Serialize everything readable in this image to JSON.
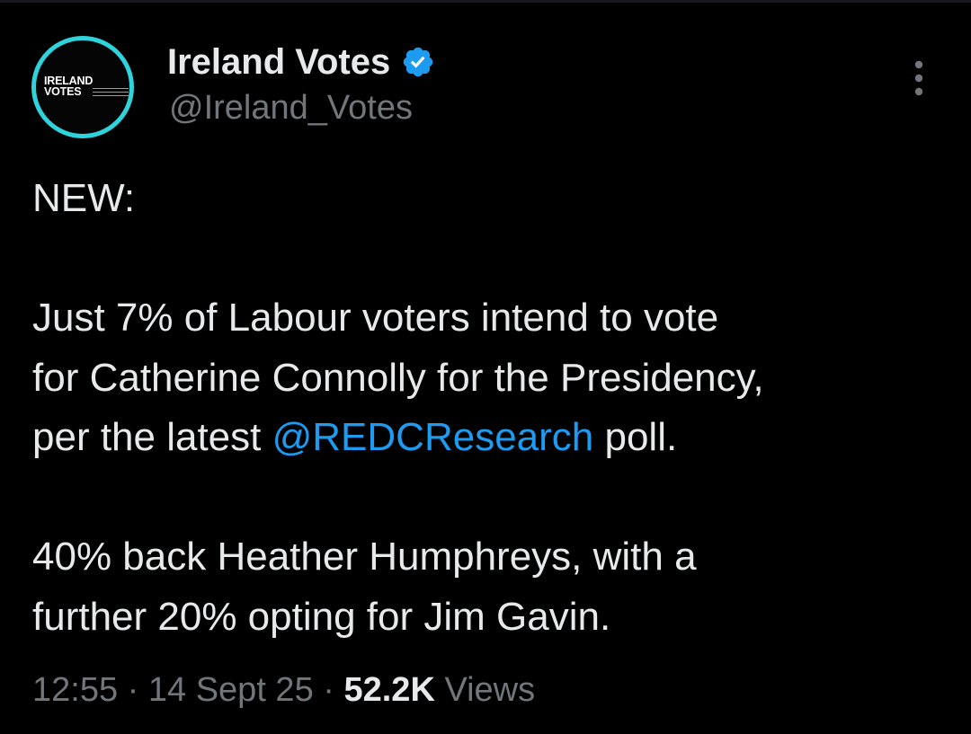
{
  "author": {
    "avatar_text": "IRELAND\nVOTES",
    "display_name": "Ireland Votes",
    "handle": "@Ireland_Votes",
    "verified": true
  },
  "tweet": {
    "line1": "NEW:",
    "line2": "Just 7% of Labour voters intend to vote",
    "line3": "for Catherine Connolly for the Presidency,",
    "line4_pre": "per the latest ",
    "mention": "@REDCResearch",
    "line4_post": " poll.",
    "line5": "40% back Heather Humphreys, with a",
    "line6": "further 20% opting for Jim Gavin."
  },
  "meta": {
    "time": "12:55",
    "separator": " · ",
    "date": "14 Sept 25",
    "views_count": "52.2K",
    "views_label": " Views"
  },
  "icons": {
    "verified": "verified-badge-icon",
    "more": "more-options-icon"
  },
  "colors": {
    "background": "#000000",
    "text": "#e7e9ea",
    "muted": "#71767b",
    "link": "#1d9bf0",
    "avatar_ring": "#2fd3dc"
  }
}
